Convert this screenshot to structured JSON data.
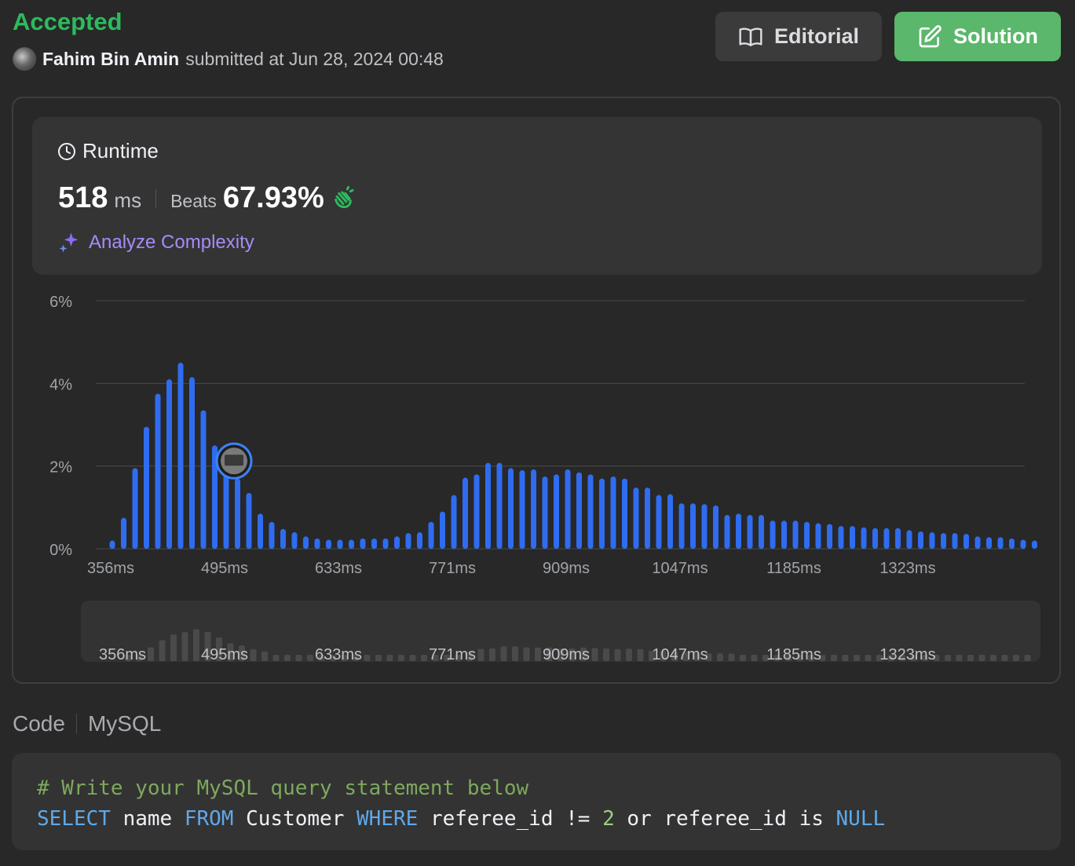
{
  "status": "Accepted",
  "submission": {
    "user": "Fahim Bin Amin",
    "text": "submitted at Jun 28, 2024 00:48"
  },
  "buttons": {
    "editorial": "Editorial",
    "solution": "Solution"
  },
  "runtime": {
    "title": "Runtime",
    "value": "518",
    "unit": "ms",
    "beats_label": "Beats",
    "beats_value": "67.93%",
    "analyze": "Analyze Complexity"
  },
  "colors": {
    "accepted": "#2cbb5d",
    "bar": "#2f6cf0",
    "solution_button": "#5bb76b",
    "analyze": "#a78bfa"
  },
  "chart_data": {
    "type": "bar",
    "title": "",
    "xlabel": "",
    "ylabel": "",
    "y_ticks": [
      "0%",
      "2%",
      "4%",
      "6%"
    ],
    "ylim": [
      0,
      6
    ],
    "x_tick_labels": [
      "356ms",
      "495ms",
      "633ms",
      "771ms",
      "909ms",
      "1047ms",
      "1185ms",
      "1323ms"
    ],
    "values": [
      0.2,
      0.75,
      1.95,
      2.95,
      3.75,
      4.1,
      4.5,
      4.15,
      3.35,
      2.5,
      2.2,
      1.7,
      1.35,
      0.85,
      0.65,
      0.48,
      0.4,
      0.3,
      0.25,
      0.22,
      0.22,
      0.22,
      0.25,
      0.25,
      0.25,
      0.3,
      0.38,
      0.4,
      0.65,
      0.9,
      1.3,
      1.72,
      1.8,
      2.08,
      2.08,
      1.95,
      1.9,
      1.92,
      1.75,
      1.8,
      1.92,
      1.85,
      1.8,
      1.7,
      1.75,
      1.7,
      1.48,
      1.48,
      1.3,
      1.32,
      1.1,
      1.1,
      1.08,
      1.05,
      0.82,
      0.85,
      0.82,
      0.82,
      0.68,
      0.68,
      0.68,
      0.65,
      0.62,
      0.6,
      0.55,
      0.55,
      0.52,
      0.5,
      0.5,
      0.5,
      0.45,
      0.42,
      0.4,
      0.38,
      0.38,
      0.36,
      0.3,
      0.28,
      0.28,
      0.25,
      0.22,
      0.2
    ],
    "highlight_index": 10,
    "grid": true
  },
  "code": {
    "label": "Code",
    "language": "MySQL",
    "comment_line": "# Write your MySQL query statement below",
    "query_tokens": [
      {
        "t": "SELECT",
        "c": "kw"
      },
      {
        "t": " name ",
        "c": "plain"
      },
      {
        "t": "FROM",
        "c": "kw"
      },
      {
        "t": " Customer ",
        "c": "plain"
      },
      {
        "t": "WHERE",
        "c": "kw"
      },
      {
        "t": " referee_id != ",
        "c": "plain"
      },
      {
        "t": "2",
        "c": "num"
      },
      {
        "t": " or referee_id is ",
        "c": "plain"
      },
      {
        "t": "NULL",
        "c": "kw"
      }
    ]
  }
}
